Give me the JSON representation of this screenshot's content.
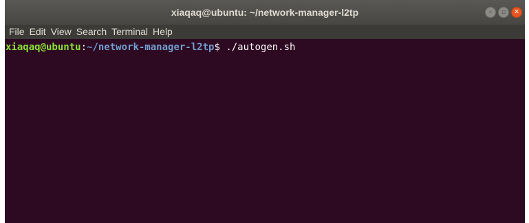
{
  "window": {
    "title": "xiaqaq@ubuntu: ~/network-manager-l2tp",
    "controls": {
      "minimize_icon": "minimize-icon",
      "maximize_icon": "maximize-icon",
      "close_icon": "close-icon",
      "minimize_glyph": "–",
      "maximize_glyph": "▫",
      "close_glyph": "✕"
    }
  },
  "menubar": {
    "items": [
      "File",
      "Edit",
      "View",
      "Search",
      "Terminal",
      "Help"
    ]
  },
  "terminal": {
    "lines": [
      {
        "user_host": "xiaqaq@ubuntu",
        "colon": ":",
        "path": "~/network-manager-l2tp",
        "symbol": "$ ",
        "command": "./autogen.sh"
      }
    ]
  },
  "colors": {
    "terminal_bg": "#2d0922",
    "titlebar_bg": "#4f4e4a",
    "menubar_bg": "#3c3b37",
    "prompt_user": "#8ae234",
    "prompt_path": "#729fcf",
    "close_button": "#e95420"
  }
}
